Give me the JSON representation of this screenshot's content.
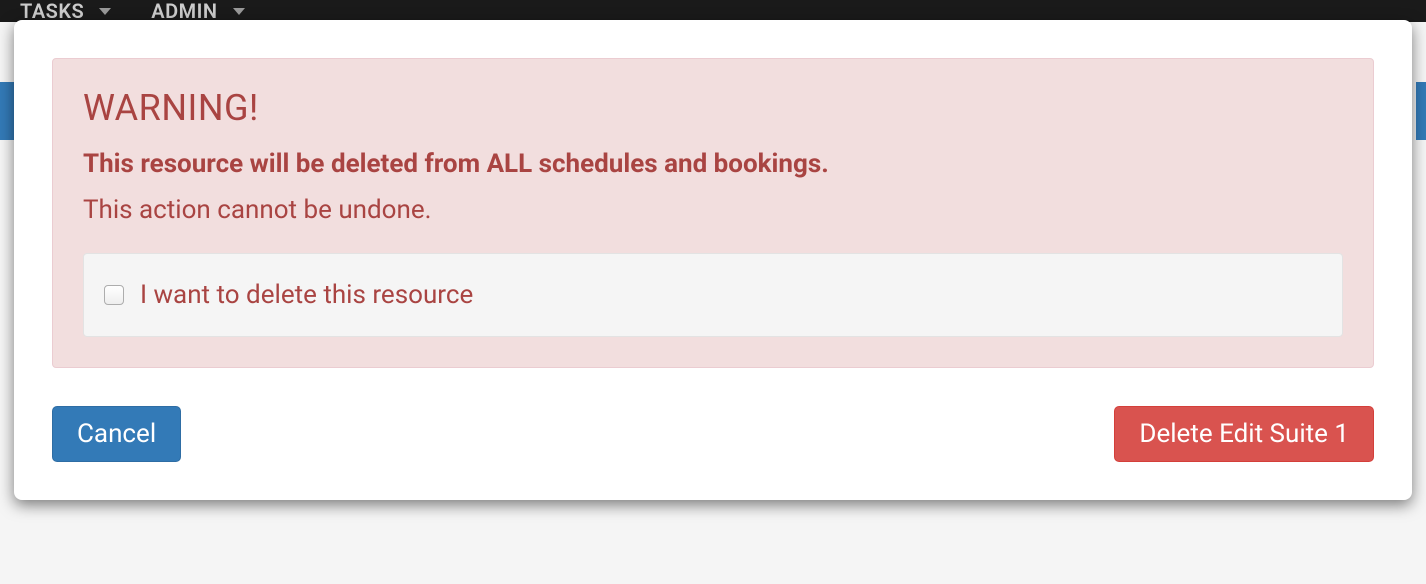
{
  "nav": {
    "items": [
      {
        "label": "TASKS"
      },
      {
        "label": "ADMIN"
      }
    ]
  },
  "modal": {
    "alert": {
      "title": "WARNING!",
      "strong": "This resource will be deleted from ALL schedules and bookings.",
      "text": "This action cannot be undone.",
      "checkbox_label": "I want to delete this resource"
    },
    "buttons": {
      "cancel": "Cancel",
      "delete": "Delete Edit Suite 1"
    }
  }
}
